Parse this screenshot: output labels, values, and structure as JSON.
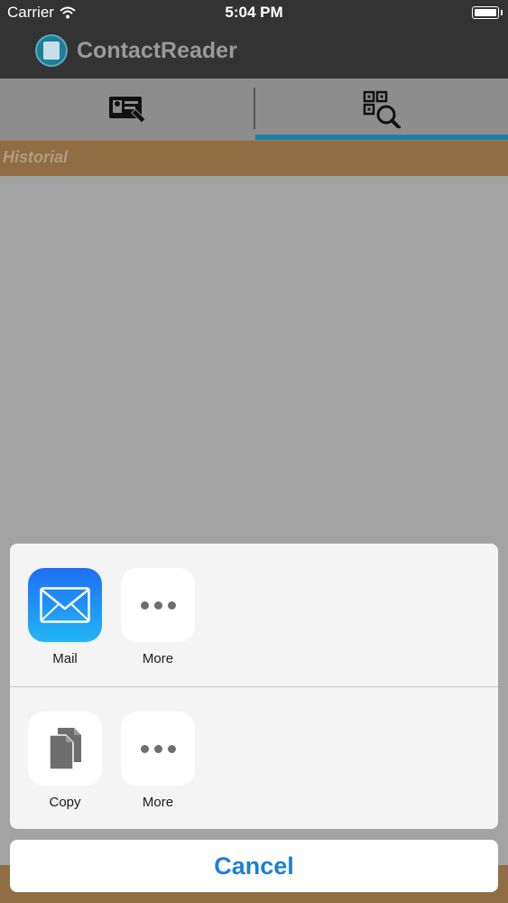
{
  "status_bar": {
    "carrier": "Carrier",
    "time": "5:04 PM",
    "icons": [
      "wifi-icon",
      "battery-icon"
    ]
  },
  "app": {
    "title": "ContactReader",
    "header_background": "#333333",
    "accent": "#1f7ea8"
  },
  "tabs": [
    {
      "icon": "business-card-icon",
      "selected": false
    },
    {
      "icon": "qr-search-icon",
      "selected": true
    }
  ],
  "section": {
    "title": "Historial"
  },
  "share_sheet": {
    "share_row": [
      {
        "label": "Mail",
        "icon": "mail-icon"
      },
      {
        "label": "More",
        "icon": "more-icon"
      }
    ],
    "action_row": [
      {
        "label": "Copy",
        "icon": "copy-icon"
      },
      {
        "label": "More",
        "icon": "more-icon"
      }
    ],
    "cancel_label": "Cancel"
  }
}
